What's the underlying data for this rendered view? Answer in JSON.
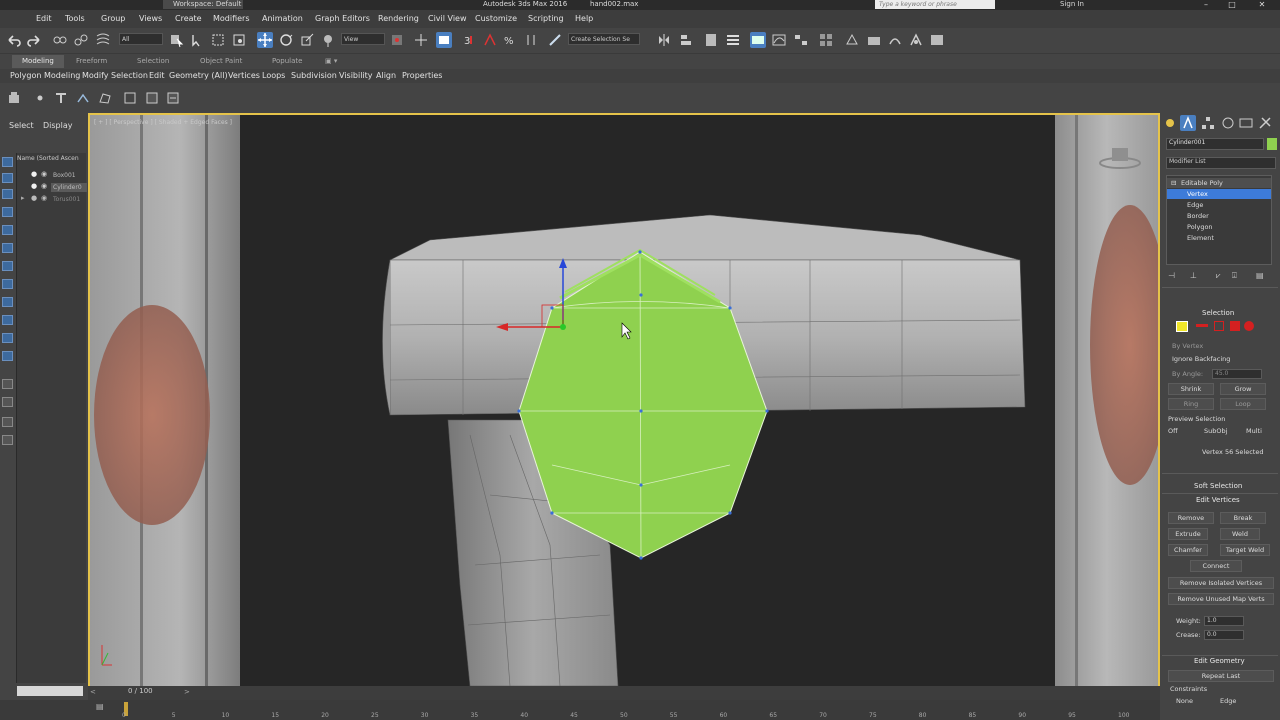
{
  "titlebar": {
    "workspace": "Workspace: Default",
    "app_title": "Autodesk 3ds Max 2016",
    "file_name": "hand002.max",
    "search_placeholder": "Type a keyword or phrase",
    "sign_in": "Sign In"
  },
  "menu": [
    "Edit",
    "Tools",
    "Group",
    "Views",
    "Create",
    "Modifiers",
    "Animation",
    "Graph Editors",
    "Rendering",
    "Civil View",
    "Customize",
    "Scripting",
    "Help"
  ],
  "toolbar": {
    "selection_filter": "All",
    "reference_coord": "View",
    "named_selection": "Create Selection Se"
  },
  "ribbon": {
    "tabs": [
      "Modeling",
      "Freeform",
      "Selection",
      "Object Paint",
      "Populate"
    ],
    "active_tab": "Modeling",
    "panels": [
      "Polygon Modeling",
      "Modify Selection",
      "Edit",
      "Geometry (All)",
      "Vertices",
      "Loops",
      "Subdivision",
      "Visibility",
      "Align",
      "Properties"
    ]
  },
  "left_panel": {
    "tabs": [
      "Select",
      "Display"
    ],
    "scene_header": "Name (Sorted Ascen",
    "objects": [
      "Box001",
      "Cylinder0",
      "Torus001"
    ]
  },
  "viewport": {
    "label": "[ + ] [ Perspective ] [ Shaded + Edged Faces ]",
    "accent_color": "#e5c34a",
    "selection_color": "#8fd14f"
  },
  "command_panel": {
    "object_name": "Cylinder001",
    "object_color": "#8fd14f",
    "modifier_list": "Modifier List",
    "stack": [
      "Editable Poly",
      "Vertex",
      "Edge",
      "Border",
      "Polygon",
      "Element"
    ],
    "selection_header": "Selection",
    "by_vertex": "By Vertex",
    "ignore_backfacing": "Ignore Backfacing",
    "by_angle": "By Angle:",
    "angle_value": "45.0",
    "shrink": "Shrink",
    "grow": "Grow",
    "ring": "Ring",
    "loop": "Loop",
    "preview_selection": "Preview Selection",
    "preview_opts": [
      "Off",
      "SubObj",
      "Multi"
    ],
    "status": "Vertex 56 Selected",
    "soft_selection": "Soft Selection",
    "edit_vertices": "Edit Vertices",
    "remove": "Remove",
    "break": "Break",
    "extrude": "Extrude",
    "weld": "Weld",
    "chamfer": "Chamfer",
    "target_weld": "Target Weld",
    "connect": "Connect",
    "remove_isolated": "Remove Isolated Vertices",
    "remove_unused": "Remove Unused Map Verts",
    "weight_label": "Weight:",
    "weight_value": "1.0",
    "crease_label": "Crease:",
    "crease_value": "0.0",
    "edit_geometry": "Edit Geometry",
    "repeat_last": "Repeat Last",
    "constraints": "Constraints",
    "constraint_opts": [
      "None",
      "Edge"
    ]
  },
  "timeline": {
    "frame": "0 / 100",
    "ticks": [
      "0",
      "5",
      "10",
      "15",
      "20",
      "25",
      "30",
      "35",
      "40",
      "45",
      "50",
      "55",
      "60",
      "65",
      "70",
      "75",
      "80",
      "85",
      "90",
      "95",
      "100"
    ]
  }
}
